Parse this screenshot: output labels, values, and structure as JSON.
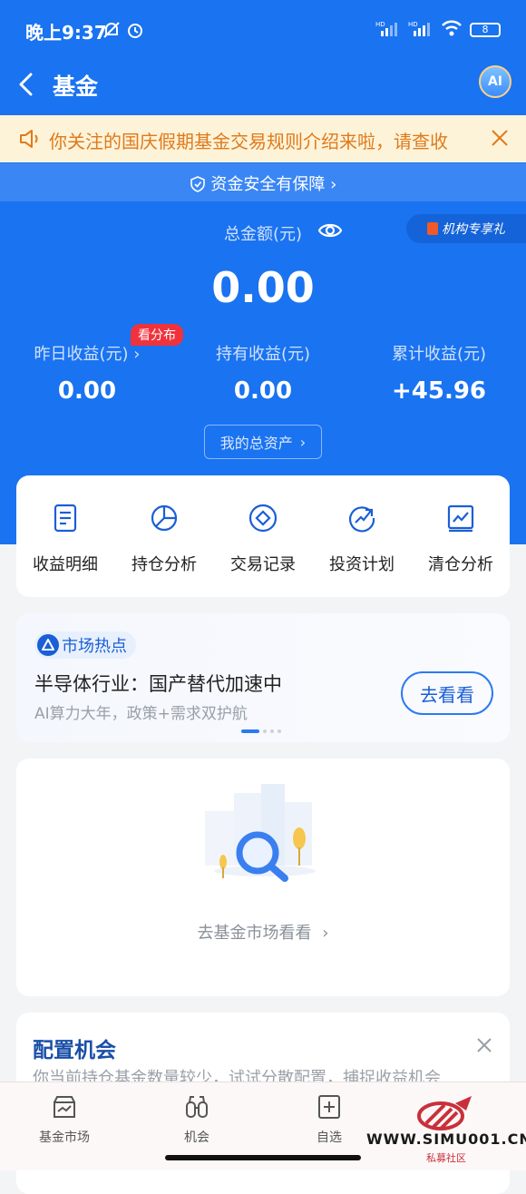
{
  "status_bar": {
    "time": "晚上9:37",
    "battery": "8",
    "hd1": "HD",
    "hd2": "HD"
  },
  "nav": {
    "title": "基金",
    "ai_label": "AI"
  },
  "notice": {
    "text": "你关注的国庆假期基金交易规则介绍来啦，请查收"
  },
  "safety": {
    "text": "资金安全有保障"
  },
  "org_badge": {
    "text": "机构专享礼"
  },
  "summary": {
    "total_label": "总金额(元)",
    "total_value": "0.00",
    "distribution_badge": "看分布",
    "stats": [
      {
        "label": "昨日收益(元)",
        "value": "0.00"
      },
      {
        "label": "持有收益(元)",
        "value": "0.00"
      },
      {
        "label": "累计收益(元)",
        "value": "+45.96"
      }
    ],
    "assets_button": "我的总资产"
  },
  "tools": [
    {
      "label": "收益明细",
      "icon": "document-icon"
    },
    {
      "label": "持仓分析",
      "icon": "pie-chart-icon"
    },
    {
      "label": "交易记录",
      "icon": "record-icon"
    },
    {
      "label": "投资计划",
      "icon": "trend-icon"
    },
    {
      "label": "清仓分析",
      "icon": "line-chart-icon"
    }
  ],
  "hot": {
    "tag": "市场热点",
    "title": "半导体行业：国产替代加速中",
    "subtitle": "AI算力大年，政策+需求双护航",
    "button": "去看看"
  },
  "empty": {
    "link": "去基金市场看看"
  },
  "config": {
    "title": "配置机会",
    "subtitle": "你当前持仓基金数量较少，试试分散配置，捕捉收益机会"
  },
  "tabbar": [
    {
      "label": "基金市场",
      "icon": "market-icon"
    },
    {
      "label": "机会",
      "icon": "binoculars-icon"
    },
    {
      "label": "自选",
      "icon": "add-favorite-icon"
    }
  ],
  "watermark": {
    "url": "WWW.SIMU001.CN",
    "cn": "私募社区"
  },
  "colors": {
    "primary": "#1a73f0",
    "accent": "#2b7af3",
    "notice": "#e07a1a",
    "badge": "#f0323c"
  }
}
